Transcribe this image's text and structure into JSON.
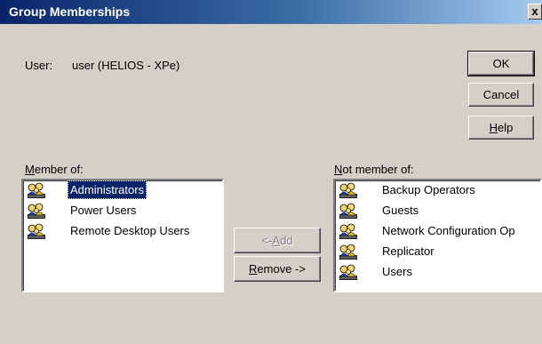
{
  "window": {
    "title": "Group Memberships",
    "close_glyph": "x"
  },
  "user": {
    "label": "User:",
    "value": "user (HELIOS - XPe)"
  },
  "buttons": {
    "ok": "OK",
    "cancel": "Cancel",
    "help_mnemonic": "H",
    "help_rest": "elp",
    "add_prefix": "<- ",
    "add_mnemonic": "A",
    "add_rest": "dd",
    "remove_mnemonic": "R",
    "remove_rest": "emove ->"
  },
  "member_of": {
    "label_mnemonic": "M",
    "label_rest": "ember of:",
    "items": [
      "Administrators",
      "Power Users",
      "Remote Desktop Users"
    ],
    "selected": "Administrators",
    "icon": "group-users-icon"
  },
  "not_member_of": {
    "label_mnemonic": "N",
    "label_rest": "ot member of:",
    "items": [
      "Backup Operators",
      "Guests",
      "Network Configuration Op",
      "Replicator",
      "Users"
    ],
    "icon": "group-users-icon"
  },
  "colors": {
    "titlebar_start": "#0a246a",
    "titlebar_end": "#a6caf0",
    "dialog_bg": "#d4d0c8",
    "selection": "#0a246a"
  }
}
